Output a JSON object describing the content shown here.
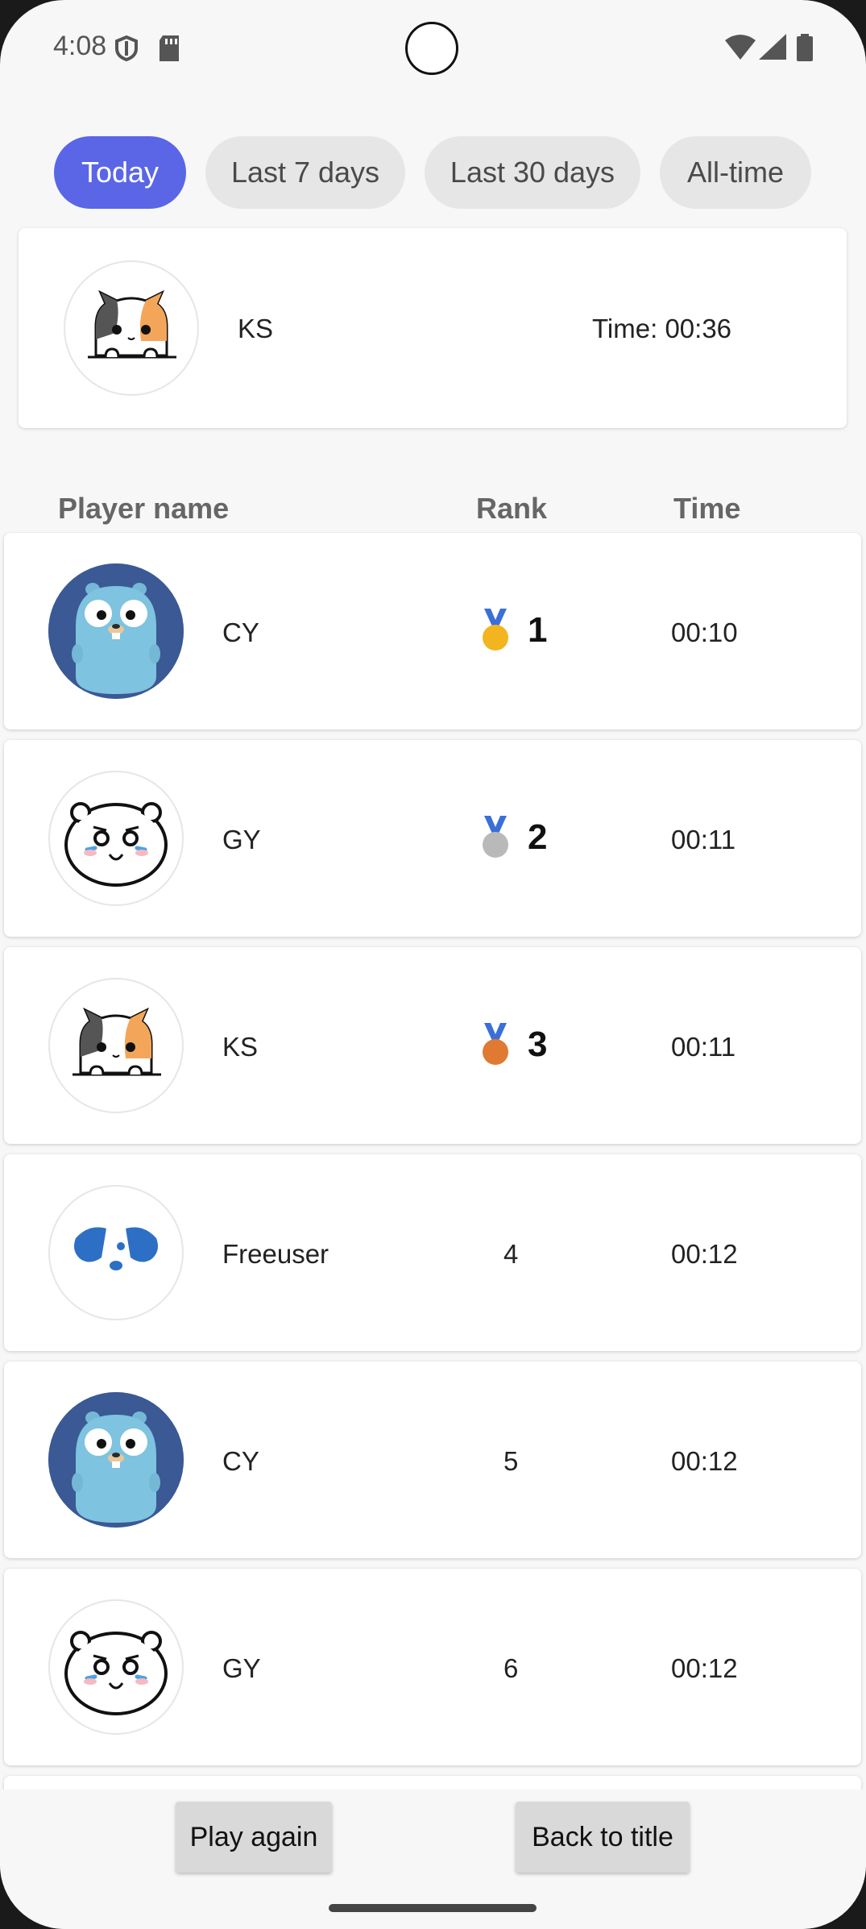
{
  "status_bar": {
    "time": "4:08"
  },
  "tabs": [
    {
      "label": "Today",
      "active": true
    },
    {
      "label": "Last 7 days",
      "active": false
    },
    {
      "label": "Last 30 days",
      "active": false
    },
    {
      "label": "All-time",
      "active": false
    }
  ],
  "my_result": {
    "name": "KS",
    "time": "Time: 00:36",
    "avatar": "calico-cat-avatar"
  },
  "header": {
    "player": "Player name",
    "rank": "Rank",
    "time": "Time"
  },
  "rows": [
    {
      "name": "CY",
      "rank": "1",
      "time": "00:10",
      "avatar": "gopher-avatar",
      "medal": "gold-medal-icon"
    },
    {
      "name": "GY",
      "rank": "2",
      "time": "00:11",
      "avatar": "hamster-avatar",
      "medal": "silver-medal-icon"
    },
    {
      "name": "KS",
      "rank": "3",
      "time": "00:11",
      "avatar": "calico-cat-avatar",
      "medal": "bronze-medal-icon"
    },
    {
      "name": "Freeuser",
      "rank": "4",
      "time": "00:12",
      "avatar": "blue-dog-avatar"
    },
    {
      "name": "CY",
      "rank": "5",
      "time": "00:12",
      "avatar": "gopher-avatar"
    },
    {
      "name": "GY",
      "rank": "6",
      "time": "00:12",
      "avatar": "hamster-avatar"
    }
  ],
  "buttons": {
    "play_again": "Play again",
    "back_to_title": "Back to title"
  },
  "colors": {
    "accent": "#5a66e6",
    "tab_inactive": "#e6e6e6",
    "background": "#f7f7f7"
  }
}
